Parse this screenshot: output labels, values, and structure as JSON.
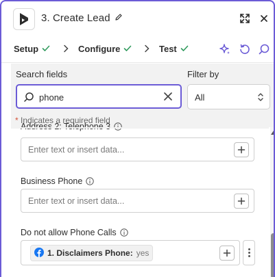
{
  "header": {
    "step_title": "3. Create Lead",
    "app_icon": "dynamics-logo-icon",
    "edit_icon": "pencil-icon",
    "expand_icon": "expand-icon",
    "close_icon": "close-icon"
  },
  "tabs": [
    {
      "label": "Setup",
      "complete": true
    },
    {
      "label": "Configure",
      "complete": true
    },
    {
      "label": "Test",
      "complete": true
    }
  ],
  "tab_actions": {
    "ai_icon": "sparkle-icon",
    "refresh_icon": "refresh-icon",
    "search_icon": "search-icon"
  },
  "search": {
    "label": "Search fields",
    "value": "phone",
    "clear_icon": "close-icon"
  },
  "filter": {
    "label": "Filter by",
    "selected": "All"
  },
  "required_note": {
    "star": "*",
    "text": " Indicates a required field"
  },
  "fields": [
    {
      "label": "Address 2: Telephone 3",
      "placeholder": "Enter text or insert data..."
    },
    {
      "label": "Business Phone",
      "placeholder": "Enter text or insert data..."
    },
    {
      "label": "Do not allow Phone Calls",
      "chip": {
        "name": "1. Disclaimers Phone:",
        "value": "yes",
        "icon": "facebook-icon"
      }
    }
  ],
  "colors": {
    "accent": "#6b5bd6",
    "check_green": "#2f9a5c",
    "required_star": "#d4533a",
    "facebook_blue": "#1877f2"
  }
}
